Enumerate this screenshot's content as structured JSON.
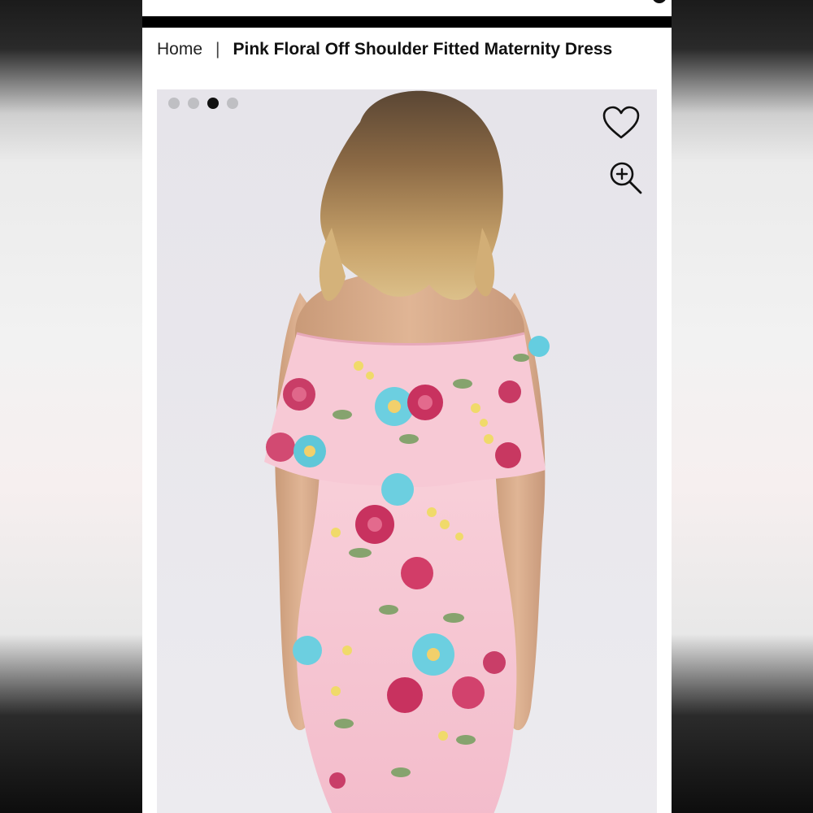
{
  "breadcrumb": {
    "home": "Home",
    "separator": "|",
    "current": "Pink Floral Off Shoulder Fitted Maternity Dress"
  },
  "gallery": {
    "image_count": 4,
    "active_index": 2,
    "image_alt": "",
    "wishlist_icon": "heart-icon",
    "zoom_icon": "zoom-in-icon"
  },
  "colors": {
    "header": "#000000",
    "dress_pink": "#f6c6d3",
    "background": "#e9e7ec"
  }
}
